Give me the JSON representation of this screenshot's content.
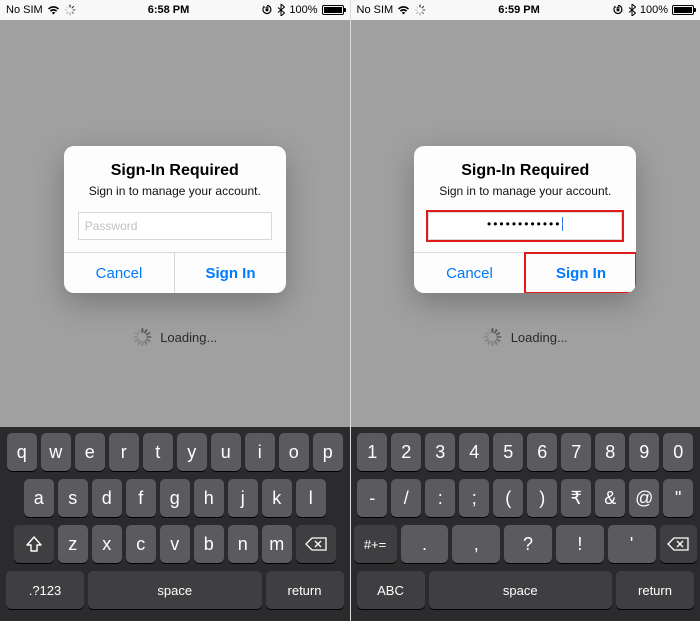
{
  "left": {
    "status": {
      "carrier": "No SIM",
      "time": "6:58 PM",
      "battery_pct": "100%"
    },
    "alert": {
      "title": "Sign-In Required",
      "message": "Sign in to manage your account.",
      "password_placeholder": "Password",
      "password_value": "",
      "cancel": "Cancel",
      "signin": "Sign In"
    },
    "loading_label": "Loading...",
    "keyboard": {
      "row1": [
        "q",
        "w",
        "e",
        "r",
        "t",
        "y",
        "u",
        "i",
        "o",
        "p"
      ],
      "row2": [
        "a",
        "s",
        "d",
        "f",
        "g",
        "h",
        "j",
        "k",
        "l"
      ],
      "row3": [
        "z",
        "x",
        "c",
        "v",
        "b",
        "n",
        "m"
      ],
      "mode_key": ".?123",
      "space_key": "space",
      "return_key": "return"
    }
  },
  "right": {
    "status": {
      "carrier": "No SIM",
      "time": "6:59 PM",
      "battery_pct": "100%"
    },
    "alert": {
      "title": "Sign-In Required",
      "message": "Sign in to manage your account.",
      "password_placeholder": "Password",
      "password_value": "••••••••••••",
      "cancel": "Cancel",
      "signin": "Sign In"
    },
    "loading_label": "Loading...",
    "keyboard": {
      "row1": [
        "1",
        "2",
        "3",
        "4",
        "5",
        "6",
        "7",
        "8",
        "9",
        "0"
      ],
      "row2": [
        "-",
        "/",
        ":",
        ";",
        "(",
        ")",
        "₹",
        "&",
        "@",
        "\""
      ],
      "row3_sym": "#+=",
      "row3_punct": [
        ".",
        ",",
        "?",
        "!",
        "'"
      ],
      "abc_key": "ABC",
      "space_key": "space",
      "return_key": "return"
    }
  }
}
